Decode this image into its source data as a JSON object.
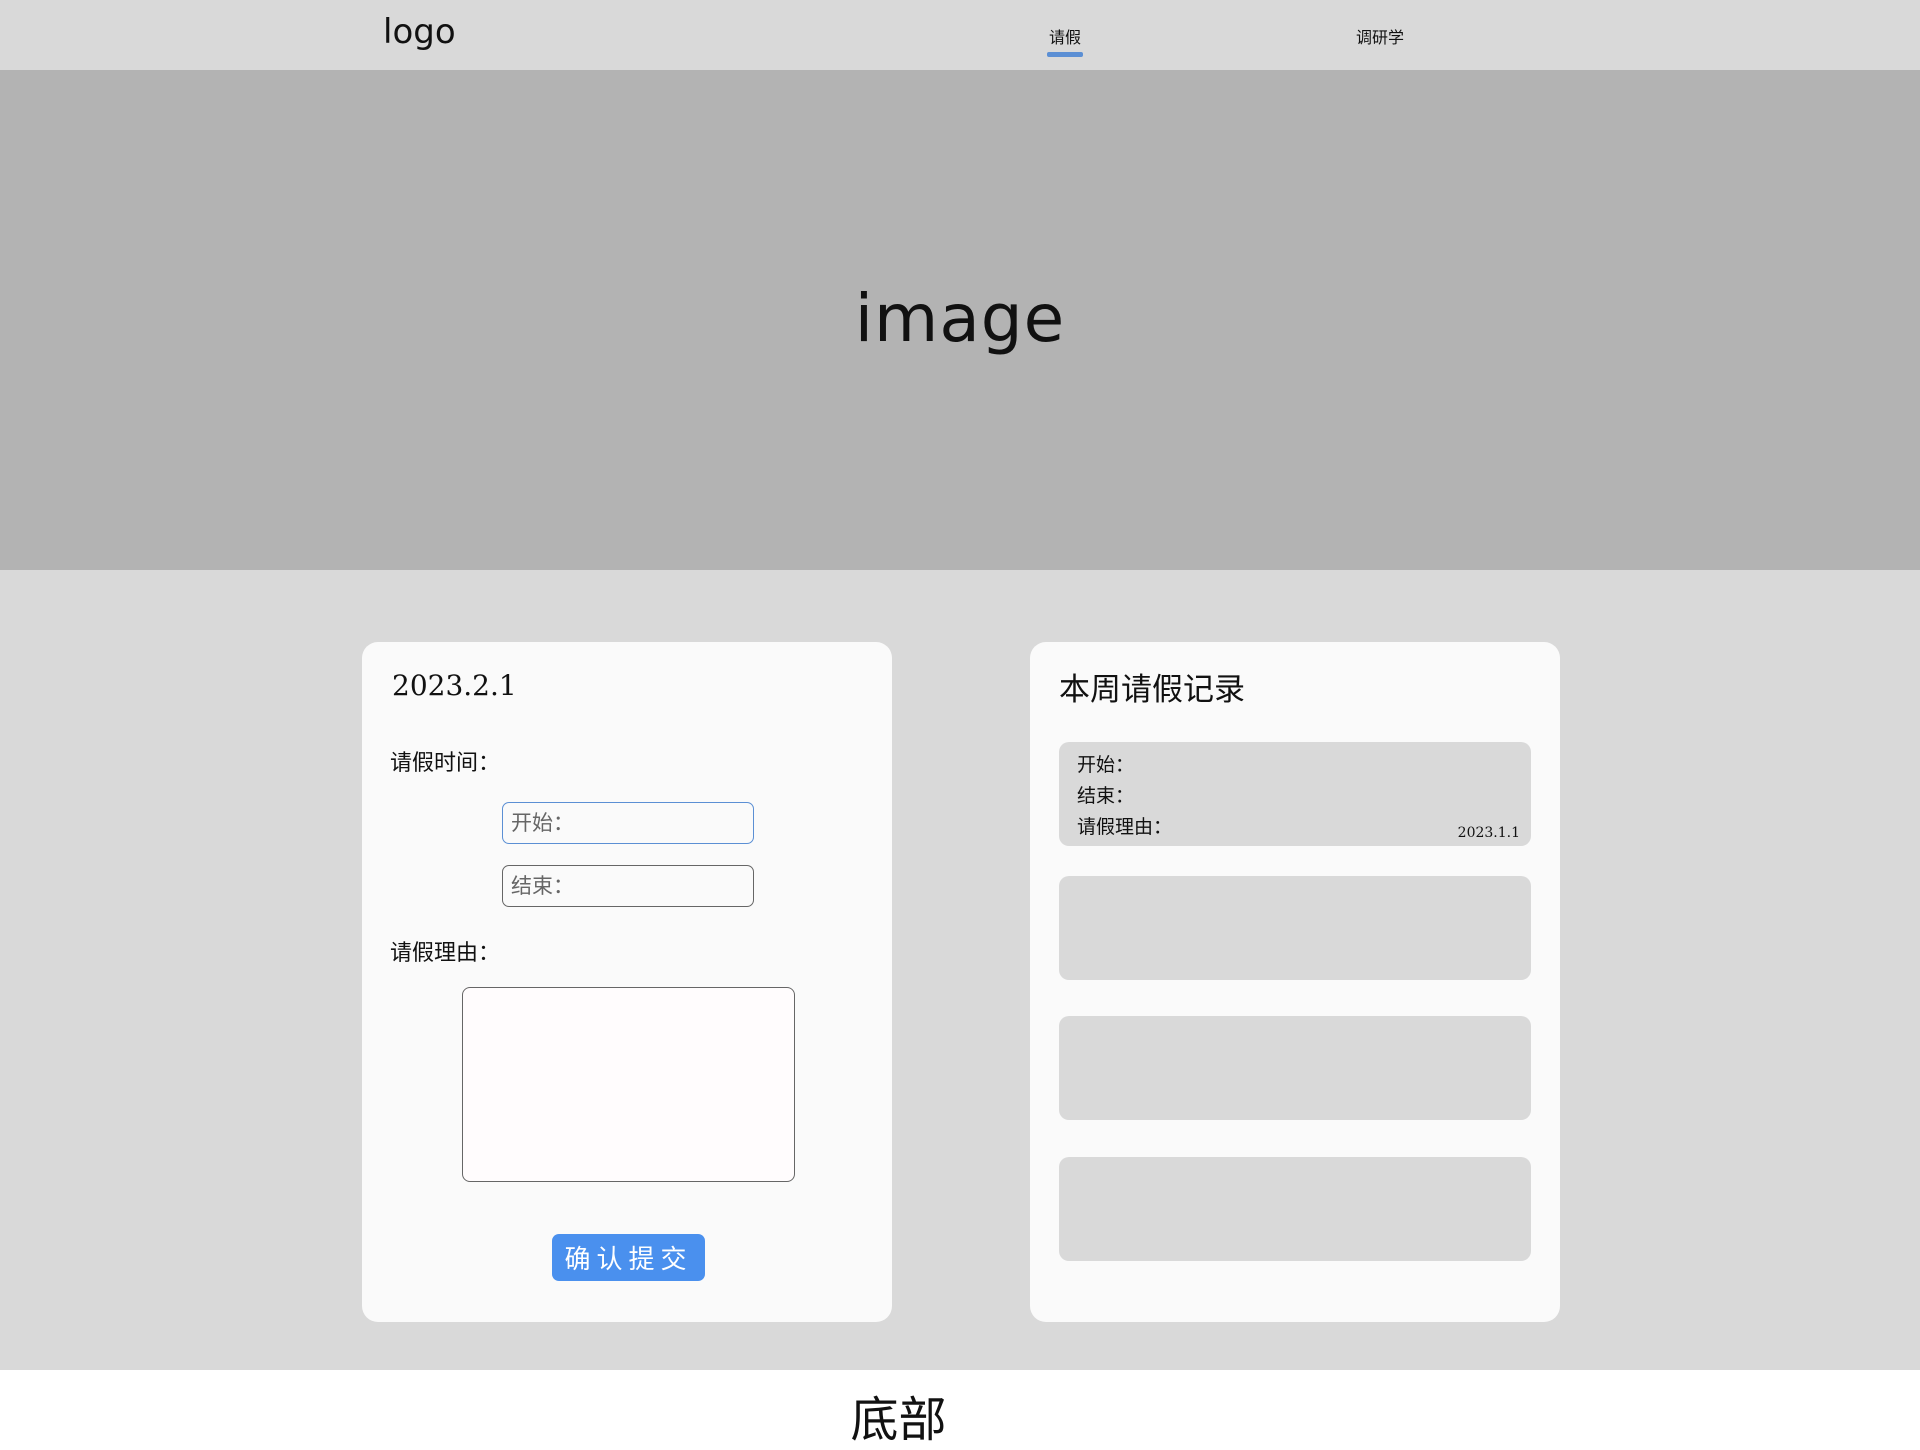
{
  "header": {
    "logo": "logo",
    "nav": [
      {
        "label": "请假",
        "active": true
      },
      {
        "label": "调研学",
        "active": false
      }
    ],
    "active_color": "#5b8fd4"
  },
  "hero": {
    "text": "image"
  },
  "leave_form": {
    "date": "2023.2.1",
    "time_label": "请假时间：",
    "start_placeholder": "开始：",
    "end_placeholder": "结束：",
    "reason_label": "请假理由：",
    "submit_label": "确认提交",
    "submit_color": "#4a90ee"
  },
  "records": {
    "title": "本周请假记录",
    "items": [
      {
        "start_label": "开始：",
        "end_label": "结束：",
        "reason_label": "请假理由：",
        "date": "2023.1.1"
      }
    ]
  },
  "footer": {
    "text": "底部"
  }
}
